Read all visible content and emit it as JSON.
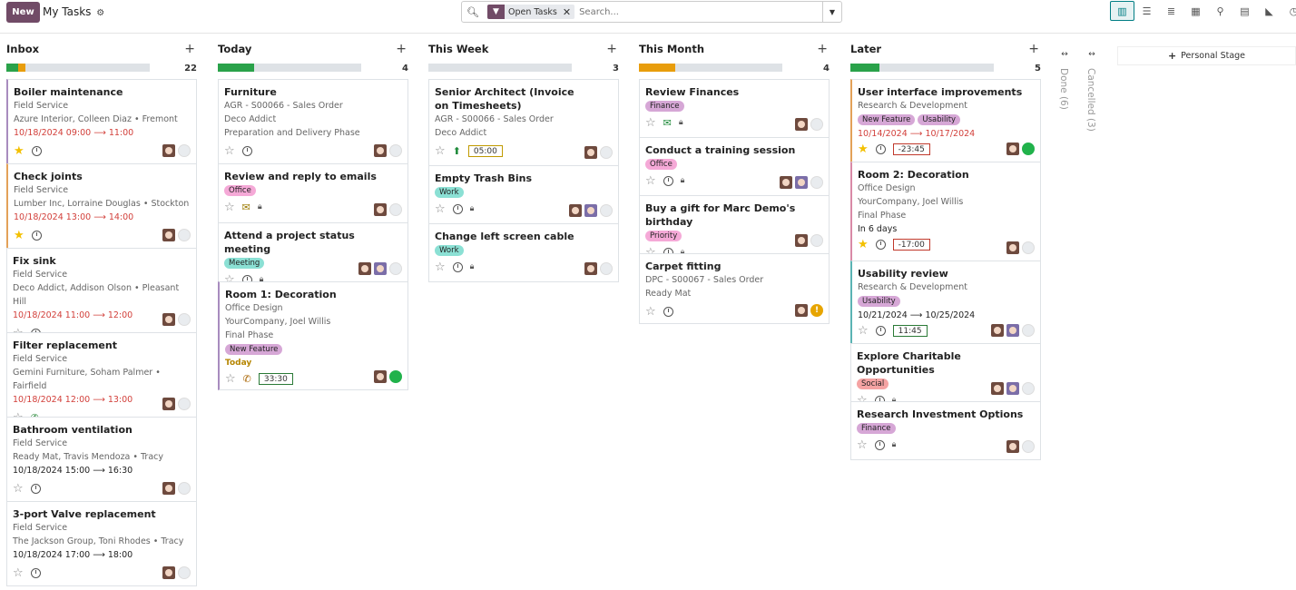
{
  "header": {
    "new_label": "New",
    "title": "My Tasks",
    "search_placeholder": "Search...",
    "facet": "Open Tasks"
  },
  "colors": {
    "brand": "#714b67",
    "green": "#2aa24a",
    "orange": "#e89d0c",
    "grey": "#dee2e6"
  },
  "columns": [
    {
      "title": "Inbox",
      "count": "22",
      "progress": [
        {
          "c": "#2aa24a",
          "w": 8
        },
        {
          "c": "#e89d0c",
          "w": 5
        }
      ]
    },
    {
      "title": "Today",
      "count": "4",
      "progress": [
        {
          "c": "#2aa24a",
          "w": 25
        }
      ]
    },
    {
      "title": "This Week",
      "count": "3",
      "progress": []
    },
    {
      "title": "This Month",
      "count": "4",
      "progress": [
        {
          "c": "#e89d0c",
          "w": 25
        }
      ]
    },
    {
      "title": "Later",
      "count": "5",
      "progress": [
        {
          "c": "#2aa24a",
          "w": 20
        }
      ]
    }
  ],
  "inbox": [
    {
      "title": "Boiler maintenance",
      "l1": "Field Service",
      "l2": "Azure Interior, Colleen Diaz • Fremont",
      "date": "10/18/2024 09:00",
      "end": "11:00"
    },
    {
      "title": "Check joints",
      "l1": "Field Service",
      "l2": "Lumber Inc, Lorraine Douglas • Stockton",
      "date": "10/18/2024 13:00",
      "end": "14:00"
    },
    {
      "title": "Fix sink",
      "l1": "Field Service",
      "l2": "Deco Addict, Addison Olson • Pleasant Hill",
      "date": "10/18/2024 11:00",
      "end": "12:00"
    },
    {
      "title": "Filter replacement",
      "l1": "Field Service",
      "l2": "Gemini Furniture, Soham Palmer • Fairfield",
      "date": "10/18/2024 12:00",
      "end": "13:00"
    },
    {
      "title": "Bathroom ventilation",
      "l1": "Field Service",
      "l2": "Ready Mat, Travis Mendoza • Tracy",
      "date": "10/18/2024 15:00",
      "end": "16:30"
    },
    {
      "title": "3-port Valve replacement",
      "l1": "Field Service",
      "l2": "The Jackson Group, Toni Rhodes • Tracy",
      "date": "10/18/2024 17:00",
      "end": "18:00"
    }
  ],
  "today": [
    {
      "title": "Furniture",
      "l1": "AGR - S00066 - Sales Order",
      "l2": "Deco Addict",
      "l3": "Preparation and Delivery Phase"
    },
    {
      "title": "Review and reply to emails",
      "tag": "Office"
    },
    {
      "title": "Attend a project status meeting",
      "tag": "Meeting"
    },
    {
      "title": "Room 1: Decoration",
      "l1": "Office Design",
      "l2": "YourCompany, Joel Willis",
      "l3": "Final Phase",
      "tag": "New Feature",
      "deadline": "Today",
      "timer": "33:30"
    }
  ],
  "week": [
    {
      "title": "Senior Architect (Invoice on Timesheets)",
      "l1": "AGR - S00066 - Sales Order",
      "l2": "Deco Addict",
      "timer": "05:00"
    },
    {
      "title": "Empty Trash Bins",
      "tag": "Work"
    },
    {
      "title": "Change left screen cable",
      "tag": "Work"
    }
  ],
  "month": [
    {
      "title": "Review Finances",
      "tag": "Finance"
    },
    {
      "title": "Conduct a training session",
      "tag": "Office"
    },
    {
      "title": "Buy a gift for Marc Demo's birthday",
      "tag": "Priority"
    },
    {
      "title": "Carpet fitting",
      "l1": "DPC - S00067 - Sales Order",
      "l2": "Ready Mat"
    }
  ],
  "later": [
    {
      "title": "User interface improvements",
      "l1": "Research & Development",
      "tag1": "New Feature",
      "tag2": "Usability",
      "date": "10/14/2024",
      "end": "10/17/2024",
      "timer": "-23:45"
    },
    {
      "title": "Room 2: Decoration",
      "l1": "Office Design",
      "l2": "YourCompany, Joel Willis",
      "l3": "Final Phase",
      "deadline": "In 6 days",
      "timer": "-17:00"
    },
    {
      "title": "Usability review",
      "l1": "Research & Development",
      "tag": "Usability",
      "date": "10/21/2024",
      "end": "10/25/2024",
      "timer": "11:45"
    },
    {
      "title": "Explore Charitable Opportunities",
      "tag": "Social"
    },
    {
      "title": "Research Investment Options",
      "tag": "Finance"
    }
  ],
  "folded": [
    {
      "label": "Done (6)"
    },
    {
      "label": "Cancelled (3)"
    }
  ],
  "personal_stage": "Personal Stage"
}
